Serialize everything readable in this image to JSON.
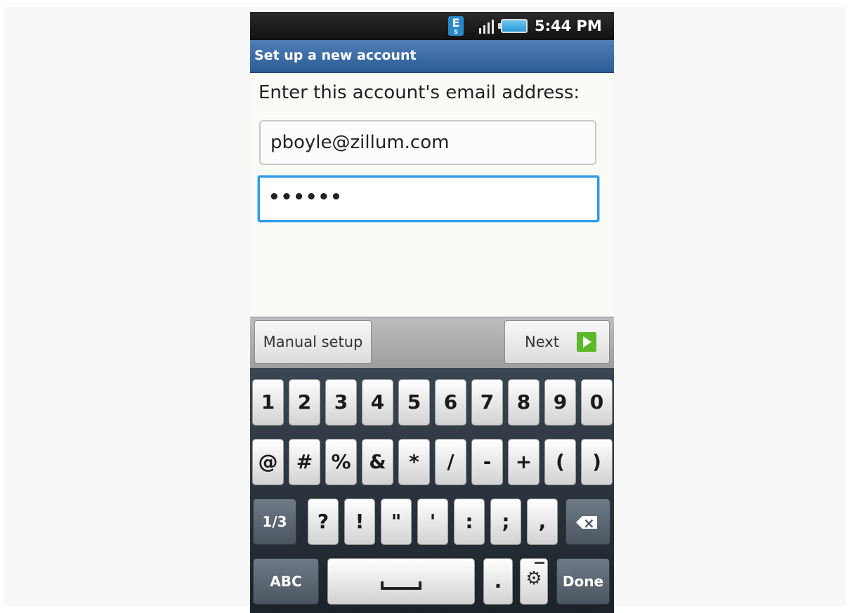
{
  "status_bar": {
    "notification_icon": "E",
    "notification_icon_sub": "S",
    "signal_icon": "signal-bars-icon",
    "battery_icon": "battery-icon",
    "time": "5:44 PM"
  },
  "title": "Set up a new account",
  "form": {
    "prompt": "Enter this account's email address:",
    "email_value": "pboyle@zillum.com",
    "password_value": "••••••"
  },
  "actions": {
    "manual_setup": "Manual setup",
    "next": "Next"
  },
  "keyboard": {
    "row1": [
      "1",
      "2",
      "3",
      "4",
      "5",
      "6",
      "7",
      "8",
      "9",
      "0"
    ],
    "row2": [
      "@",
      "#",
      "%",
      "&",
      "*",
      "/",
      "-",
      "+",
      "(",
      ")"
    ],
    "row3_mode": "1/3",
    "row3": [
      "?",
      "!",
      "\"",
      "'",
      ":",
      ";",
      ","
    ],
    "backspace_icon": "backspace-icon",
    "abc": "ABC",
    "space_icon": "space-icon",
    "period": ".",
    "settings_icon": "⚙",
    "done": "Done"
  }
}
